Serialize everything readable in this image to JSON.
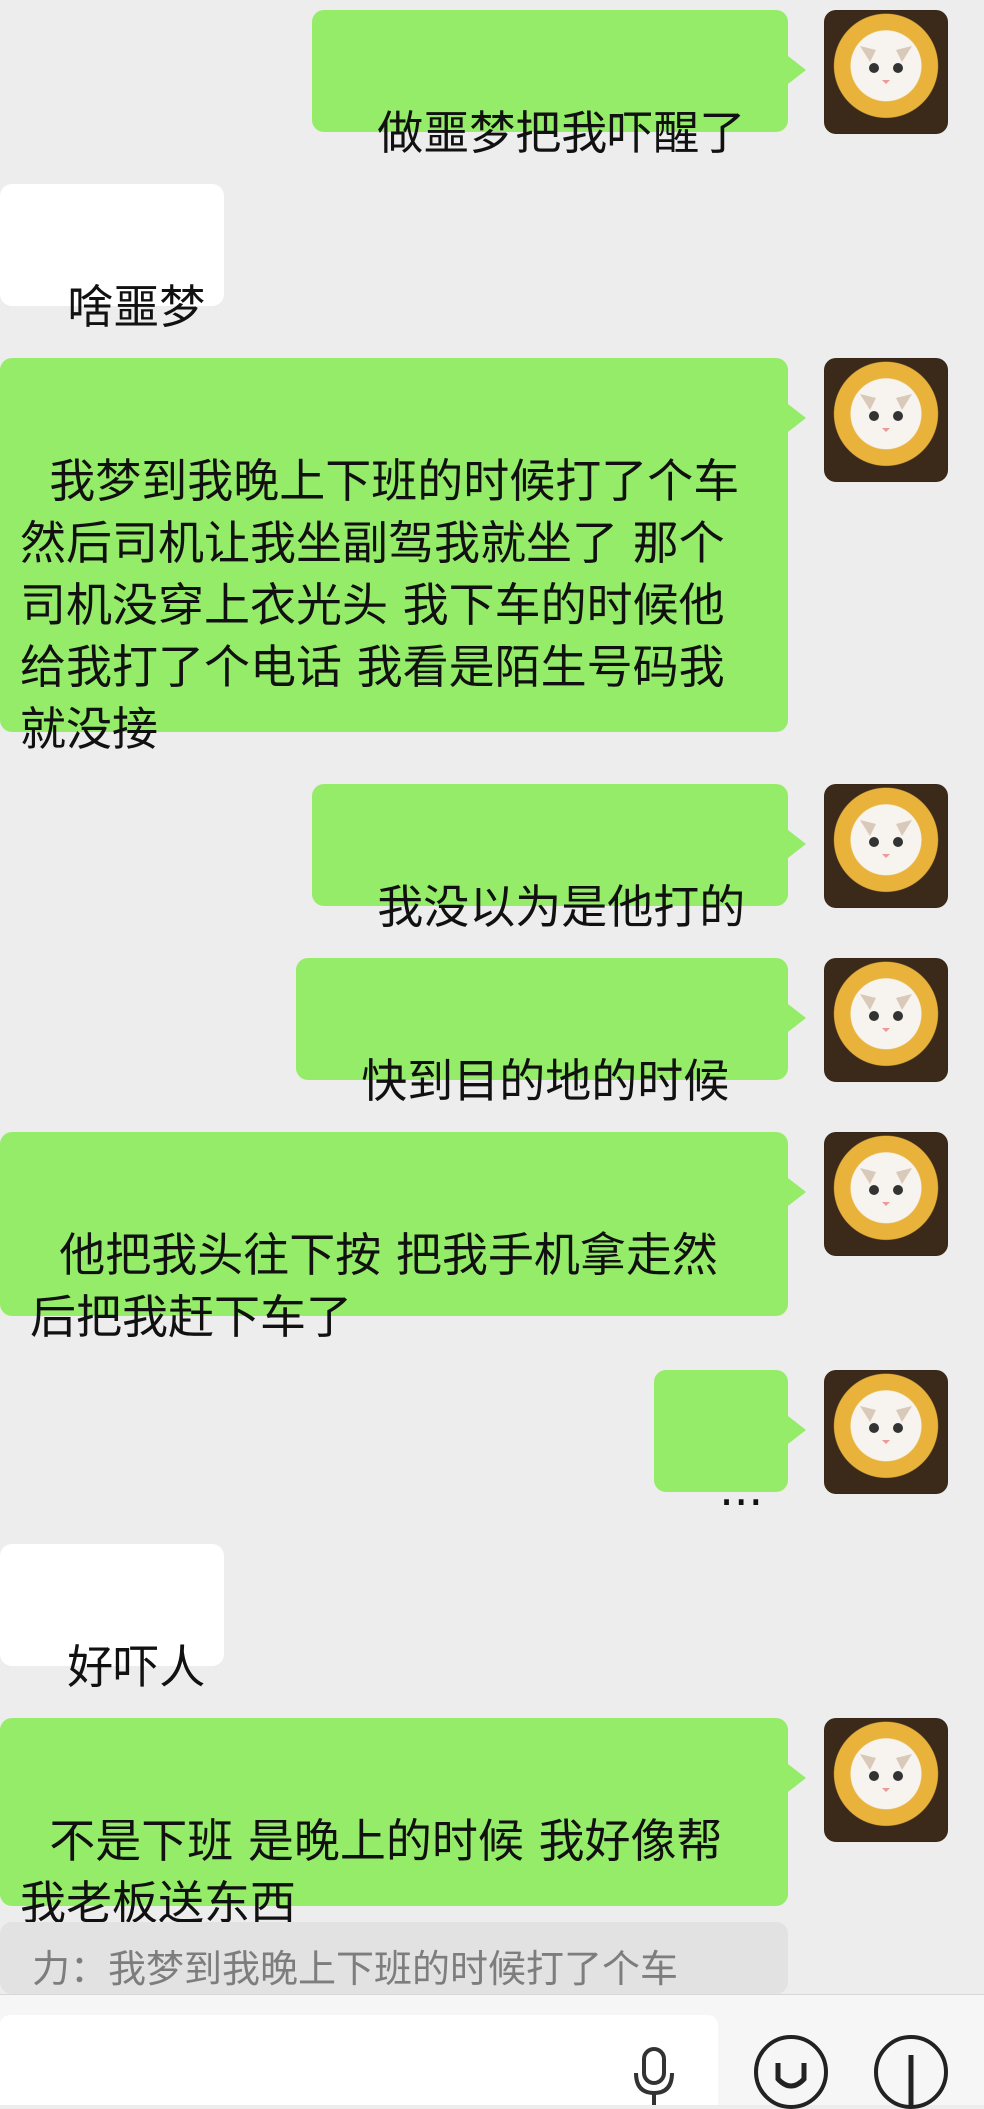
{
  "messages": [
    {
      "side": "sent",
      "text": "做噩梦把我吓醒了"
    },
    {
      "side": "received",
      "text": "啥噩梦"
    },
    {
      "side": "sent",
      "text": "我梦到我晚上下班的时候打了个车 然后司机让我坐副驾我就坐了 那个司机没穿上衣光头 我下车的时候他给我打了个电话 我看是陌生号码我就没接"
    },
    {
      "side": "sent",
      "text": "我没以为是他打的"
    },
    {
      "side": "sent",
      "text": "快到目的地的时候"
    },
    {
      "side": "sent",
      "text": "他把我头往下按 把我手机拿走然后把我赶下车了"
    },
    {
      "side": "sent",
      "text": "..."
    },
    {
      "side": "received",
      "text": "好吓人"
    },
    {
      "side": "sent",
      "text": "不是下班 是晚上的时候 我好像帮我老板送东西"
    }
  ],
  "quote": {
    "text": "力：我梦到我晚上下班的时候打了个车"
  },
  "icons": {
    "avatar": "kitten-avatar",
    "mic": "microphone-icon",
    "emoji": "emoji-icon",
    "more": "add-icon"
  },
  "colors": {
    "background": "#ededed",
    "sent_bubble": "#95ec69",
    "received_bubble": "#ffffff"
  }
}
